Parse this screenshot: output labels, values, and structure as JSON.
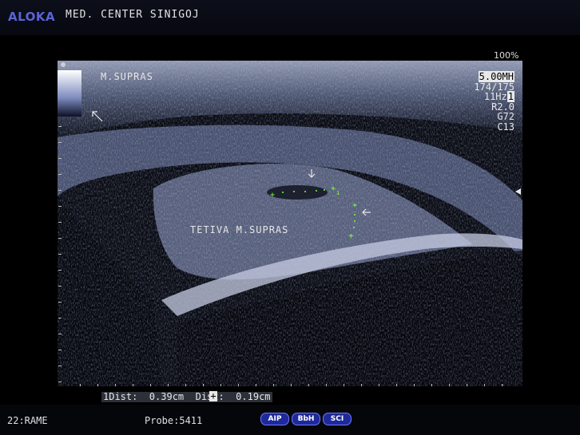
{
  "header": {
    "brand": "ALOKA",
    "center_name": "MED. CENTER SINIGOJ"
  },
  "display": {
    "zoom": "100%"
  },
  "image_labels": {
    "muscle": "M.SUPRAS",
    "tendon": "TETIVA M.SUPRAS"
  },
  "scan_params": {
    "frequency": "5.00MH",
    "frame": "174/175",
    "frame_rate": "11Hz",
    "focus": "1",
    "r": "R2.0",
    "gain": "G72",
    "contrast": "C13"
  },
  "measurements": {
    "text": "1Dist:  0.39cm  Dist:  0.19cm",
    "marker": "+"
  },
  "footer": {
    "preset": "22:RAME",
    "probe": "Probe:5411",
    "badges": [
      "AIP",
      "BbH",
      "SCI"
    ]
  },
  "colors": {
    "brand": "#5b63d6",
    "caliper": "#7dff3c",
    "badge": "#1e2a9a"
  }
}
